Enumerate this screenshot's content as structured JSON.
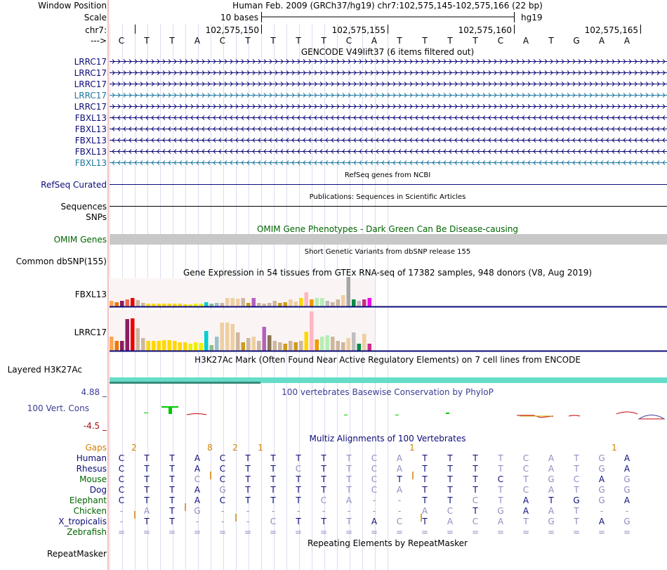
{
  "header": {
    "window_position_label": "Window Position",
    "scale_label": "Scale",
    "chrom_label": "chr7:",
    "strand_label": "--->",
    "assembly_title": "Human Feb. 2009 (GRCh37/hg19)   chr7:102,575,145-102,575,166 (22 bp)",
    "scale_text": "10 bases",
    "db_label": "hg19",
    "coords": [
      "102,575,150",
      "102,575,155",
      "102,575,160",
      "102,575,165"
    ]
  },
  "bases": [
    "C",
    "T",
    "T",
    "A",
    "C",
    "T",
    "T",
    "T",
    "T",
    "C",
    "A",
    "T",
    "T",
    "T",
    "T",
    "C",
    "A",
    "T",
    "G",
    "A",
    "A"
  ],
  "gencode": {
    "title": "GENCODE V49lift37 (6 items filtered out)",
    "tracks": [
      {
        "name": "LRRC17",
        "dir": "right",
        "color": "#0c0c78"
      },
      {
        "name": "LRRC17",
        "dir": "right",
        "color": "#0c0c78"
      },
      {
        "name": "LRRC17",
        "dir": "right",
        "color": "#0c0c78"
      },
      {
        "name": "LRRC17",
        "dir": "right",
        "color": "#1e78a0"
      },
      {
        "name": "LRRC17",
        "dir": "right",
        "color": "#0c0c78"
      },
      {
        "name": "FBXL13",
        "dir": "left",
        "color": "#0c0c78"
      },
      {
        "name": "FBXL13",
        "dir": "left",
        "color": "#0c0c78"
      },
      {
        "name": "FBXL13",
        "dir": "left",
        "color": "#0c0c78"
      },
      {
        "name": "FBXL13",
        "dir": "left",
        "color": "#0c0c78"
      },
      {
        "name": "FBXL13",
        "dir": "left",
        "color": "#1e78a0"
      }
    ]
  },
  "refseq": {
    "title": "RefSeq genes from NCBI",
    "label": "RefSeq Curated"
  },
  "pubs": {
    "title": "Publications: Sequences in Scientific Articles",
    "label1": "Sequences",
    "label2": "SNPs"
  },
  "omim": {
    "title": "OMIM Gene Phenotypes - Dark Green Can Be Disease-causing",
    "label": "OMIM Genes"
  },
  "dbsnp": {
    "title": "Short Genetic Variants from dbSNP release 155",
    "label": "Common dbSNP(155)"
  },
  "gtex": {
    "title": "Gene Expression in 54 tissues from GTEx RNA-seq of 17382 samples, 948 donors (V8, Aug 2019)",
    "genes": [
      {
        "name": "FBXL13",
        "values": [
          8,
          6,
          8,
          10,
          12,
          9,
          5,
          4,
          4,
          4,
          4,
          4,
          4,
          4,
          3,
          3,
          4,
          4,
          6,
          4,
          5,
          5,
          12,
          12,
          11,
          12,
          5,
          12,
          5,
          4,
          5,
          8,
          5,
          6,
          10,
          7,
          12,
          20,
          10,
          12,
          12,
          8,
          6,
          10,
          16,
          42,
          10,
          8,
          10,
          12
        ],
        "colors": [
          "#ffa54f",
          "#ee7600",
          "#8b1c62",
          "#ee6a50",
          "#ee0000",
          "#cdb79e",
          "#cdb79e",
          "#ffd700",
          "#ffd700",
          "#ffd700",
          "#ffd700",
          "#ffd700",
          "#ffd700",
          "#ffd700",
          "#ffd700",
          "#eeee00",
          "#eeee00",
          "#eeee00",
          "#00ced1",
          "#8fbc8f",
          "#9ac0cd",
          "#cdb79e",
          "#eecfa1",
          "#eecfa1",
          "#eecfa1",
          "#cdb79e",
          "#cd9b1d",
          "#b460bd",
          "#cdb79e",
          "#cdb79e",
          "#cdb79e",
          "#cdb79e",
          "#cd9b1d",
          "#cd9b1d",
          "#eecfa1",
          "#eecfa1",
          "#ffd700",
          "#ffb6c1",
          "#ee9a00",
          "#b4eeb4",
          "#b4eeb4",
          "#bebebe",
          "#cdb79e",
          "#cdb79e",
          "#eecfa1",
          "#a6a6a6",
          "#008b45",
          "#bebebe",
          "#cd2990",
          "#ee00ee"
        ]
      },
      {
        "name": "LRRC17",
        "values": [
          20,
          14,
          14,
          45,
          46,
          32,
          18,
          14,
          14,
          14,
          15,
          15,
          14,
          12,
          12,
          10,
          12,
          11,
          28,
          8,
          20,
          40,
          40,
          38,
          26,
          12,
          18,
          20,
          14,
          34,
          22,
          14,
          12,
          10,
          14,
          12,
          14,
          27,
          56,
          16,
          20,
          22,
          20,
          14,
          12,
          18,
          26,
          10,
          24,
          10
        ],
        "colors": [
          "#ffa54f",
          "#ee7600",
          "#8b1c62",
          "#8b1c62",
          "#ee0000",
          "#cdb79e",
          "#cdb79e",
          "#ffd700",
          "#ffd700",
          "#ffd700",
          "#ffd700",
          "#ffd700",
          "#ffd700",
          "#ffd700",
          "#ffd700",
          "#eeee00",
          "#eeee00",
          "#eeee00",
          "#00ced1",
          "#8fbc8f",
          "#9ac0cd",
          "#eecfa1",
          "#eecfa1",
          "#eecfa1",
          "#cdb79e",
          "#cd9b1d",
          "#cdb79e",
          "#eecfa1",
          "#cdb79e",
          "#b460bd",
          "#8b7355",
          "#cdb79e",
          "#cdb79e",
          "#cd9b1d",
          "#cdb79e",
          "#cd9b1d",
          "#cdb79e",
          "#ffd700",
          "#ffb6c1",
          "#ee9a00",
          "#b4eeb4",
          "#b4eeb4",
          "#cdb79e",
          "#cdb79e",
          "#cdb79e",
          "#eecfa1",
          "#bebebe",
          "#008b45",
          "#eecfa1",
          "#cd2990"
        ]
      }
    ]
  },
  "h3k27ac": {
    "title": "H3K27Ac Mark (Often Found Near Active Regulatory Elements) on 7 cell lines from ENCODE",
    "label": "Layered H3K27Ac"
  },
  "phylop": {
    "title": "100 vertebrates Basewise Conservation by PhyloP",
    "label": "100 Vert. Cons",
    "max_label": "4.88 _",
    "min_label": "-4.5 _"
  },
  "multiz": {
    "title": "Multiz Alignments of 100 Vertebrates",
    "gaps_label": "Gaps",
    "gaps": [
      "2",
      "",
      "",
      "8",
      "2",
      "1",
      "",
      "",
      "",
      "",
      "",
      "1",
      "",
      "",
      "",
      "",
      "",
      "",
      "",
      "1",
      ""
    ],
    "species": [
      {
        "name": "Human",
        "color": "#0c0c78",
        "seq": [
          "C",
          "T",
          "T",
          "A",
          "C",
          "T",
          "T",
          "T",
          "T",
          "T",
          "C",
          "A",
          "T",
          "T",
          "T",
          "T",
          "C",
          "A",
          "T",
          "G",
          "A",
          "A"
        ]
      },
      {
        "name": "Rhesus",
        "color": "#0c0c78",
        "seq": [
          "C",
          "T",
          "T",
          "A",
          "C",
          "T",
          "T",
          "C",
          "T",
          "T",
          "C",
          "A",
          "T",
          "T",
          "T",
          "T",
          "C",
          "A",
          "T",
          "G",
          "A",
          "A"
        ]
      },
      {
        "name": "Mouse",
        "color": "#006400",
        "seq": [
          "C",
          "T",
          "T",
          "C",
          "C",
          "T",
          "T",
          "T",
          "T",
          "T",
          "C",
          "T",
          "T",
          "T",
          "T",
          "C",
          "T",
          "G",
          "C",
          "A",
          "G",
          "G"
        ]
      },
      {
        "name": "Dog",
        "color": "#0c0c78",
        "seq": [
          "C",
          "T",
          "T",
          "A",
          "G",
          "T",
          "T",
          "T",
          "T",
          "T",
          "C",
          "A",
          "T",
          "T",
          "T",
          "T",
          "C",
          "A",
          "T",
          "G",
          "G",
          "G"
        ]
      },
      {
        "name": "Elephant",
        "color": "#006400",
        "seq": [
          "C",
          "T",
          "T",
          "A",
          "C",
          "T",
          "T",
          "T",
          "C",
          "A",
          "-",
          "-",
          "T",
          "T",
          "C",
          "T",
          "A",
          "T",
          "G",
          "G",
          "A",
          "C"
        ]
      },
      {
        "name": "Chicken",
        "color": "#006400",
        "seq": [
          "-",
          "A",
          "T",
          "G",
          "-",
          "-",
          "-",
          "-",
          "-",
          "-",
          "-",
          "-",
          "A",
          "C",
          "T",
          "G",
          "A",
          "A",
          "T",
          "-",
          "-",
          "-"
        ]
      },
      {
        "name": "X_tropicalis",
        "color": "#0c0c78",
        "seq": [
          "-",
          "T",
          "T",
          "-",
          "-",
          "-",
          "C",
          "T",
          "T",
          "T",
          "A",
          "C",
          "T",
          "A",
          "C",
          "A",
          "T",
          "G",
          "T",
          "A",
          "G",
          "T"
        ]
      },
      {
        "name": "Zebrafish",
        "color": "#006400",
        "seq": [
          "=",
          "=",
          "=",
          "=",
          "=",
          "=",
          "=",
          "=",
          "=",
          "=",
          "=",
          "=",
          "=",
          "=",
          "=",
          "=",
          "=",
          "=",
          "=",
          "=",
          "=",
          "="
        ]
      }
    ]
  },
  "repeatmasker": {
    "title": "Repeating Elements by RepeatMasker",
    "label": "RepeatMasker"
  },
  "colors": {
    "navy": "#0c0c78",
    "green": "#006400",
    "gap_orange": "#d08000",
    "divider": "#e08080",
    "phylop_pos": "#00c800",
    "phylop_neg": "#c80000",
    "h3k27ac": "#66ddc8",
    "omim_gray": "#c8c8c8"
  }
}
